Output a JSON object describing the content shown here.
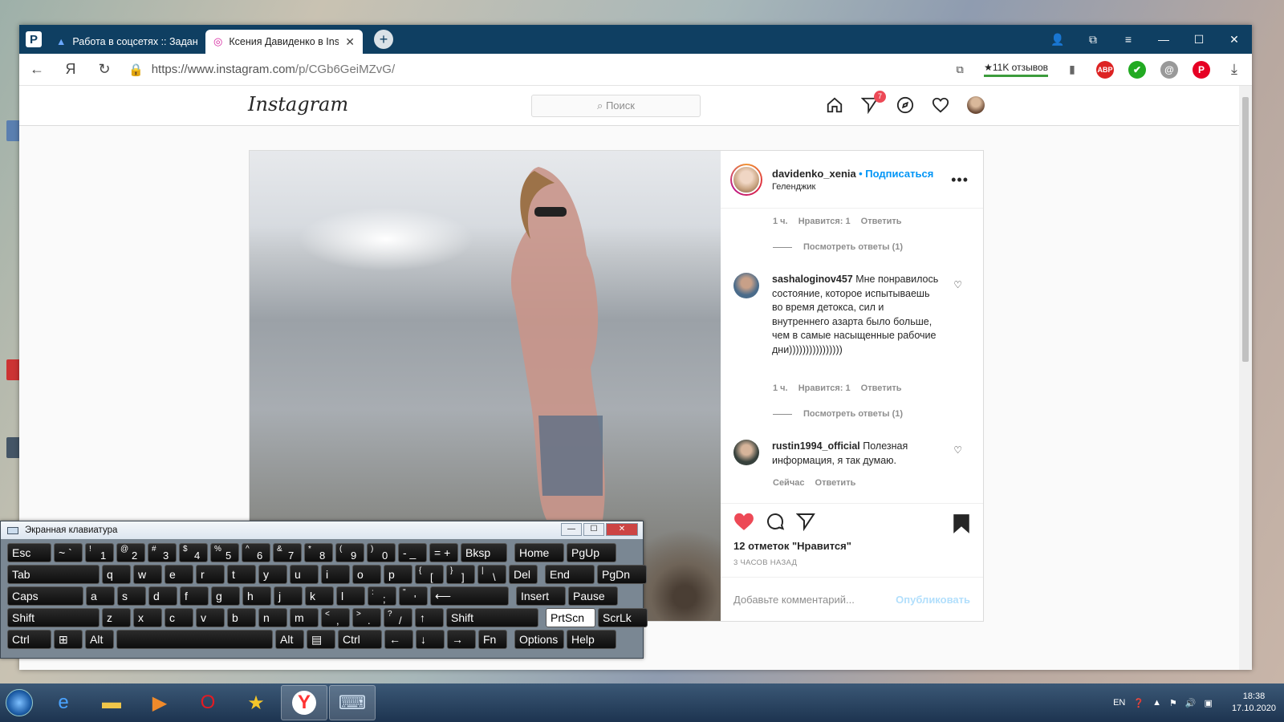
{
  "browser": {
    "tabs": [
      {
        "title": "Работа в соцсетях :: Задан",
        "icon": "task-icon"
      },
      {
        "title": "Ксения Давиденко в Ins",
        "icon": "instagram-icon"
      }
    ],
    "new_tab": "+",
    "url_host": "https://www.instagram.com",
    "url_path": "/p/CGb6GeiMZvG/",
    "reviews": "★11K отзывов",
    "abp": "ABP",
    "nav_yandex": "Я"
  },
  "instagram": {
    "logo": "Instagram",
    "search_placeholder": "Поиск",
    "notif_count": "7",
    "post": {
      "username": "davidenko_xenia",
      "follow": "• Подписаться",
      "location": "Геленджик",
      "more": "•••",
      "comments": [
        {
          "time": "1 ч.",
          "likes": "Нравится: 1",
          "reply": "Ответить",
          "view_replies": "Посмотреть ответы (1)"
        },
        {
          "author": "sashaloginov457",
          "text": "Мне понравилось состояние, которое испытываешь во время детокса, сил и внутреннего азарта было больше, чем в самые насыщенные рабочие дни))))))))))))))))",
          "time": "1 ч.",
          "likes": "Нравится: 1",
          "reply": "Ответить",
          "view_replies": "Посмотреть ответы (1)"
        },
        {
          "author": "rustin1994_official",
          "text": "Полезная информация, я так думаю.",
          "time": "Сейчас",
          "reply": "Ответить"
        }
      ],
      "likes_text": "12 отметок \"Нравится\"",
      "posted_ago": "3 ЧАСОВ НАЗАД",
      "comment_placeholder": "Добавьте комментарий...",
      "publish": "Опубликовать"
    }
  },
  "osk": {
    "title": "Экранная клавиатура",
    "rows": [
      [
        [
          "Esc",
          ""
        ],
        [
          "~ `",
          ""
        ],
        [
          "1",
          "!"
        ],
        [
          "2",
          "@"
        ],
        [
          "3",
          "#"
        ],
        [
          "4",
          "$"
        ],
        [
          "5",
          "%"
        ],
        [
          "6",
          "^"
        ],
        [
          "7",
          "&"
        ],
        [
          "8",
          "*"
        ],
        [
          "9",
          "("
        ],
        [
          "0",
          ")"
        ],
        [
          "- _",
          ""
        ],
        [
          "= +",
          ""
        ],
        [
          "Bksp",
          ""
        ],
        [
          "Home",
          ""
        ],
        [
          "PgUp",
          ""
        ]
      ],
      [
        [
          "Tab",
          ""
        ],
        [
          "q",
          ""
        ],
        [
          "w",
          ""
        ],
        [
          "e",
          ""
        ],
        [
          "r",
          ""
        ],
        [
          "t",
          ""
        ],
        [
          "y",
          ""
        ],
        [
          "u",
          ""
        ],
        [
          "i",
          ""
        ],
        [
          "o",
          ""
        ],
        [
          "p",
          ""
        ],
        [
          "[",
          "{"
        ],
        [
          "]",
          "}"
        ],
        [
          "\\",
          "|"
        ],
        [
          "Del",
          ""
        ],
        [
          "End",
          ""
        ],
        [
          "PgDn",
          ""
        ]
      ],
      [
        [
          "Caps",
          ""
        ],
        [
          "a",
          ""
        ],
        [
          "s",
          ""
        ],
        [
          "d",
          ""
        ],
        [
          "f",
          ""
        ],
        [
          "g",
          ""
        ],
        [
          "h",
          ""
        ],
        [
          "j",
          ""
        ],
        [
          "k",
          ""
        ],
        [
          "l",
          ""
        ],
        [
          ";",
          ":"
        ],
        [
          "'",
          "\""
        ],
        [
          "⟵",
          ""
        ],
        [
          "Insert",
          ""
        ],
        [
          "Pause",
          ""
        ]
      ],
      [
        [
          "Shift",
          ""
        ],
        [
          "z",
          ""
        ],
        [
          "x",
          ""
        ],
        [
          "c",
          ""
        ],
        [
          "v",
          ""
        ],
        [
          "b",
          ""
        ],
        [
          "n",
          ""
        ],
        [
          "m",
          ""
        ],
        [
          ",",
          "<"
        ],
        [
          ".",
          ">"
        ],
        [
          "/",
          "?"
        ],
        [
          "↑",
          ""
        ],
        [
          "Shift",
          ""
        ],
        [
          "PrtScn",
          ""
        ],
        [
          "ScrLk",
          ""
        ]
      ],
      [
        [
          "Ctrl",
          ""
        ],
        [
          "⊞",
          ""
        ],
        [
          "Alt",
          ""
        ],
        [
          "",
          ""
        ],
        [
          "Alt",
          ""
        ],
        [
          "▤",
          ""
        ],
        [
          "Ctrl",
          ""
        ],
        [
          "←",
          ""
        ],
        [
          "↓",
          ""
        ],
        [
          "→",
          ""
        ],
        [
          "Fn",
          ""
        ],
        [
          "Options",
          ""
        ],
        [
          "Help",
          ""
        ]
      ]
    ]
  },
  "taskbar": {
    "lang": "EN",
    "time": "18:38",
    "date": "17.10.2020"
  },
  "colors": {
    "tabbar": "#0f3f62",
    "ig_blue": "#0095f6",
    "like_red": "#ed4956"
  }
}
